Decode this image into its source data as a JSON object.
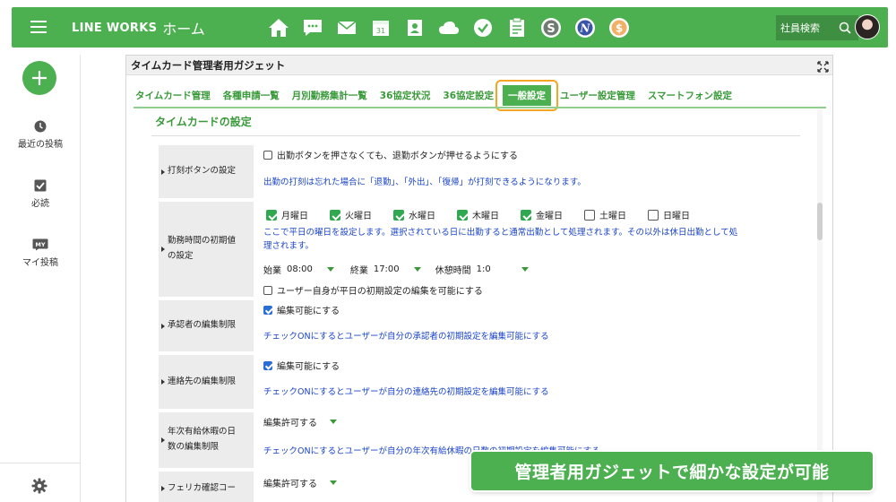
{
  "header": {
    "brand_name": "LINE WORKS",
    "brand_sub": "ホーム",
    "search_label": "社員検索",
    "accent": "#4caf50"
  },
  "apps": [
    {
      "name": "home-icon"
    },
    {
      "name": "chat-icon"
    },
    {
      "name": "mail-icon"
    },
    {
      "name": "calendar-icon",
      "text": "31"
    },
    {
      "name": "contacts-icon"
    },
    {
      "name": "drive-icon"
    },
    {
      "name": "task-icon"
    },
    {
      "name": "form-icon"
    },
    {
      "name": "s-app-icon",
      "text": "S"
    },
    {
      "name": "n-app-icon",
      "text": "N"
    },
    {
      "name": "dollar-app-icon",
      "text": "$"
    }
  ],
  "leftnav": {
    "items": [
      {
        "label": "最近の投稿"
      },
      {
        "label": "必読"
      },
      {
        "label": "マイ投稿"
      }
    ],
    "my_badge": "MY"
  },
  "gadget": {
    "title": "タイムカード管理者用ガジェット",
    "tabs": [
      "タイムカード管理",
      "各種申請一覧",
      "月別勤務集計一覧",
      "36協定状況",
      "36協定設定",
      "一般設定",
      "ユーザー設定管理",
      "スマートフォン設定"
    ],
    "active_tab": "一般設定",
    "section_title": "タイムカードの設定"
  },
  "settings": {
    "stamp": {
      "label": "打刻ボタンの設定",
      "checkbox": "出勤ボタンを押さなくても、退勤ボタンが押せるようにする",
      "note": "出勤の打刻は忘れた場合に「退勤」、「外出」、「復帰」が打刻できるようになります。"
    },
    "worktime": {
      "label_line1": "勤務時間の初期値",
      "label_line2": "の設定",
      "days": [
        {
          "name": "月曜日",
          "checked": true
        },
        {
          "name": "火曜日",
          "checked": true
        },
        {
          "name": "水曜日",
          "checked": true
        },
        {
          "name": "木曜日",
          "checked": true
        },
        {
          "name": "金曜日",
          "checked": true
        },
        {
          "name": "土曜日",
          "checked": false
        },
        {
          "name": "日曜日",
          "checked": false
        }
      ],
      "note_line1": "ここで平日の曜日を設定します。選択されている日に出勤すると通常出勤として処理されます。その以外は休日出勤として処",
      "note_line2": "理されます。",
      "start_label": "始業",
      "start_value": "08:00",
      "end_label": "終業",
      "end_value": "17:00",
      "break_label": "休憩時間",
      "break_value": "1:0",
      "user_edit": "ユーザー自身が平日の初期設定の編集を可能にする"
    },
    "approver": {
      "label": "承認者の編集制限",
      "checkbox": "編集可能にする",
      "note": "チェックONにするとユーザーが自分の承認者の初期設定を編集可能にする"
    },
    "contact": {
      "label": "連絡先の編集制限",
      "checkbox": "編集可能にする",
      "note": "チェックONにするとユーザーが自分の連絡先の初期設定を編集可能にする"
    },
    "paid_leave": {
      "label_line1": "年次有給休暇の日",
      "label_line2": "数の編集制限",
      "select": "編集許可する",
      "note": "チェックONにするとユーザーが自分の年次有給休暇の日数の初期設定を編集可能にする"
    },
    "felica": {
      "label": "フェリカ確認コー",
      "select": "編集許可する"
    }
  },
  "caption": "管理者用ガジェットで細かな設定が可能"
}
